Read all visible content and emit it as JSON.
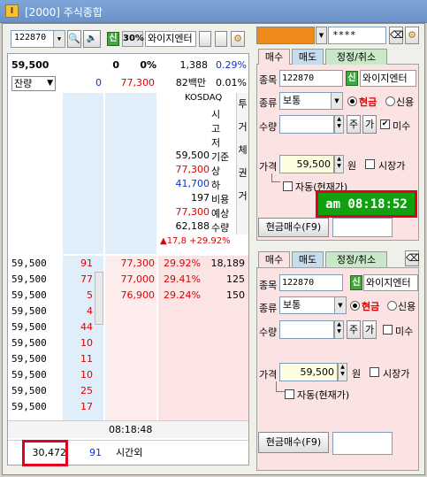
{
  "window": {
    "title": "[2000] 주식종합",
    "icon": "app-icon"
  },
  "toolbar": {
    "code": "122870",
    "pct": "30%",
    "name": "와이지엔터",
    "shin": "신"
  },
  "summary": {
    "price": "59,500",
    "change": "0",
    "rate": "0%",
    "volume": "1,388",
    "vol_pct": "0.29%",
    "label_remain": "잔량",
    "remain": "0",
    "remain_price": "77,300",
    "amount": "82백만",
    "amount_pct": "0.01%"
  },
  "info": {
    "market": "KOSDAQ",
    "side_labels": [
      "투",
      "거",
      "체",
      "권",
      "거"
    ],
    "rows": [
      {
        "label": "시",
        "value": ""
      },
      {
        "label": "고",
        "value": ""
      },
      {
        "label": "저",
        "value": ""
      },
      {
        "label": "기준",
        "value": "59,500"
      },
      {
        "label": "상",
        "value": "77,300"
      },
      {
        "label": "하",
        "value": "41,700"
      },
      {
        "label": "비용",
        "value": "197"
      },
      {
        "label": "예상",
        "value": "77,300"
      },
      {
        "label": "수량",
        "value": "62,188"
      },
      {
        "label": "",
        "value": "▲17,8  +29.92%"
      }
    ]
  },
  "asks_right": [
    {
      "price": "77,300",
      "pct": "29.92%",
      "qty": "18,189"
    },
    {
      "price": "77,000",
      "pct": "29.41%",
      "qty": "125"
    },
    {
      "price": "76,900",
      "pct": "29.24%",
      "qty": "150"
    }
  ],
  "bids": [
    {
      "price": "59,500",
      "qty": "91"
    },
    {
      "price": "59,500",
      "qty": "77"
    },
    {
      "price": "59,500",
      "qty": "5"
    },
    {
      "price": "59,500",
      "qty": "4"
    },
    {
      "price": "59,500",
      "qty": "44"
    },
    {
      "price": "59,500",
      "qty": "10"
    },
    {
      "price": "59,500",
      "qty": "11"
    },
    {
      "price": "59,500",
      "qty": "10"
    },
    {
      "price": "59,500",
      "qty": "25"
    },
    {
      "price": "59,500",
      "qty": "17"
    }
  ],
  "footer": {
    "time": "08:18:48",
    "total": "30,472",
    "total2": "91",
    "label": "시간외"
  },
  "account": {
    "pw": "****"
  },
  "buy_panel": {
    "tabs": [
      "매수",
      "매도",
      "정정/취소"
    ],
    "label_code": "종목",
    "code": "122870",
    "shin": "신",
    "name": "와이지엔터",
    "label_type": "종류",
    "type": "보통",
    "cash": "현금",
    "credit": "신용",
    "label_qty": "수량",
    "btn_ju": "주",
    "btn_ga": "가",
    "misu": "미수",
    "label_price": "가격",
    "price": "59,500",
    "unit": "원",
    "market_price": "시장가",
    "auto": "자동(현재가)",
    "submit": "현금매수(F9)"
  },
  "time_overlay": "am 08:18:52",
  "order_panel": {
    "tabs": [
      "매수",
      "매도",
      "정정/취소"
    ],
    "label_code": "종목",
    "code": "122870",
    "shin": "신",
    "name": "와이지엔터",
    "label_type": "종류",
    "type": "보통",
    "cash": "현금",
    "credit": "신용",
    "label_qty": "수량",
    "btn_ju": "주",
    "btn_ga": "가",
    "misu": "미수",
    "label_price": "가격",
    "price": "59,500",
    "unit": "원",
    "market_price": "시장가",
    "auto": "자동(현재가)",
    "submit": "현금매수(F9)"
  },
  "colors": {
    "highlight": "#e00020",
    "time_bg": "#10a010"
  }
}
